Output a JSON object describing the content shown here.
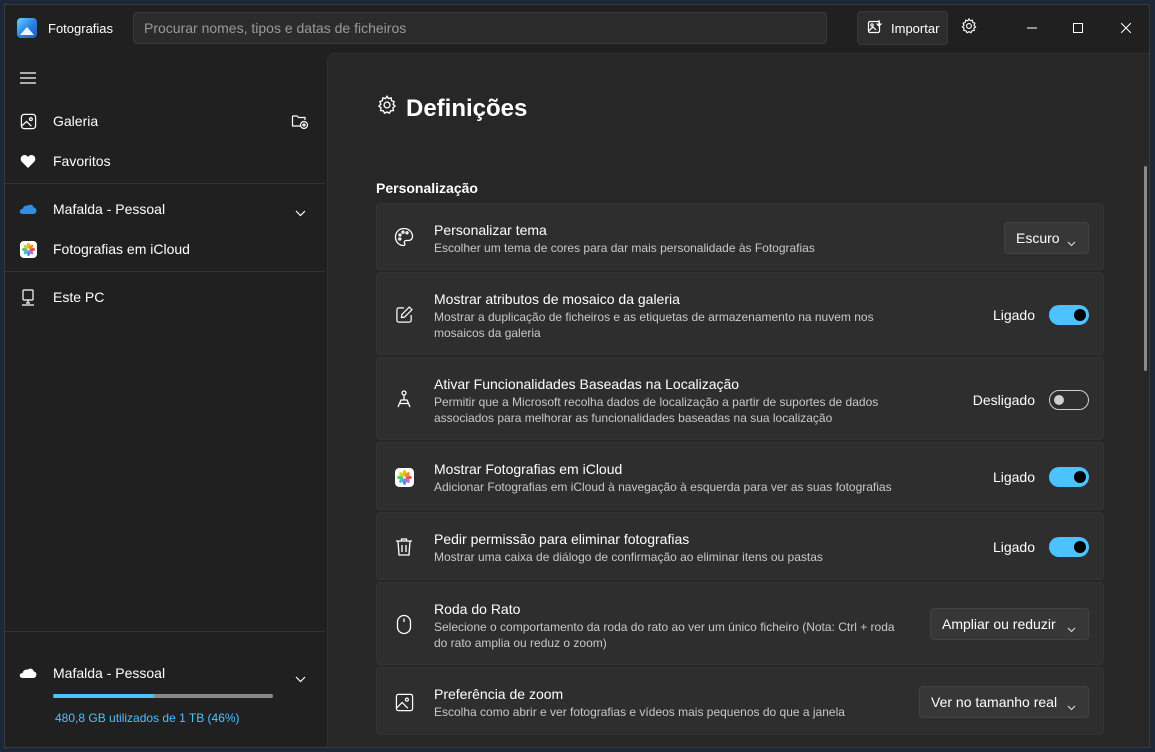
{
  "app": {
    "title": "Fotografias"
  },
  "search": {
    "placeholder": "Procurar nomes, tipos e datas de ficheiros"
  },
  "toolbar": {
    "import_label": "Importar"
  },
  "sidebar": {
    "items": [
      {
        "label": "Galeria",
        "icon": "gallery-icon"
      },
      {
        "label": "Favoritos",
        "icon": "heart-icon"
      },
      {
        "label": "Mafalda - Pessoal",
        "icon": "onedrive-icon"
      },
      {
        "label": "Fotografias em iCloud",
        "icon": "icloud-photos-icon"
      },
      {
        "label": "Este PC",
        "icon": "pc-icon"
      }
    ],
    "storage": {
      "account": "Mafalda - Pessoal",
      "usage_text": "480,8 GB utilizados de 1 TB (46%)",
      "used_fraction": 0.46
    }
  },
  "settings": {
    "title": "Definições",
    "section": "Personalização",
    "cards": [
      {
        "title": "Personalizar tema",
        "desc": "Escolher um tema de cores para dar mais personalidade às Fotografias",
        "control": "dropdown",
        "value": "Escuro"
      },
      {
        "title": "Mostrar atributos de mosaico da galeria",
        "desc": "Mostrar a duplicação de ficheiros e as etiquetas de armazenamento na nuvem nos mosaicos da galeria",
        "control": "toggle",
        "state": "Ligado",
        "on": true
      },
      {
        "title": "Ativar Funcionalidades Baseadas na Localização",
        "desc": "Permitir que a Microsoft recolha dados de localização a partir de suportes de dados associados para melhorar as funcionalidades baseadas na sua localização",
        "control": "toggle",
        "state": "Desligado",
        "on": false
      },
      {
        "title": "Mostrar Fotografias em iCloud",
        "desc": "Adicionar Fotografias em iCloud à navegação à esquerda para ver as suas fotografias",
        "control": "toggle",
        "state": "Ligado",
        "on": true
      },
      {
        "title": "Pedir permissão para eliminar fotografias",
        "desc": "Mostrar uma caixa de diálogo de confirmação ao eliminar itens ou pastas",
        "control": "toggle",
        "state": "Ligado",
        "on": true
      },
      {
        "title": "Roda do Rato",
        "desc": "Selecione o comportamento da roda do rato ao ver um único ficheiro (Nota: Ctrl + roda do rato amplia ou reduz o zoom)",
        "control": "dropdown",
        "value": "Ampliar ou reduzir"
      },
      {
        "title": "Preferência de zoom",
        "desc": "Escolha como abrir e ver fotografias e vídeos mais pequenos do que a janela",
        "control": "dropdown",
        "value": "Ver no tamanho real"
      }
    ]
  },
  "colors": {
    "accent": "#4cc2ff",
    "background": "#202020",
    "card": "#2e2e2e"
  }
}
